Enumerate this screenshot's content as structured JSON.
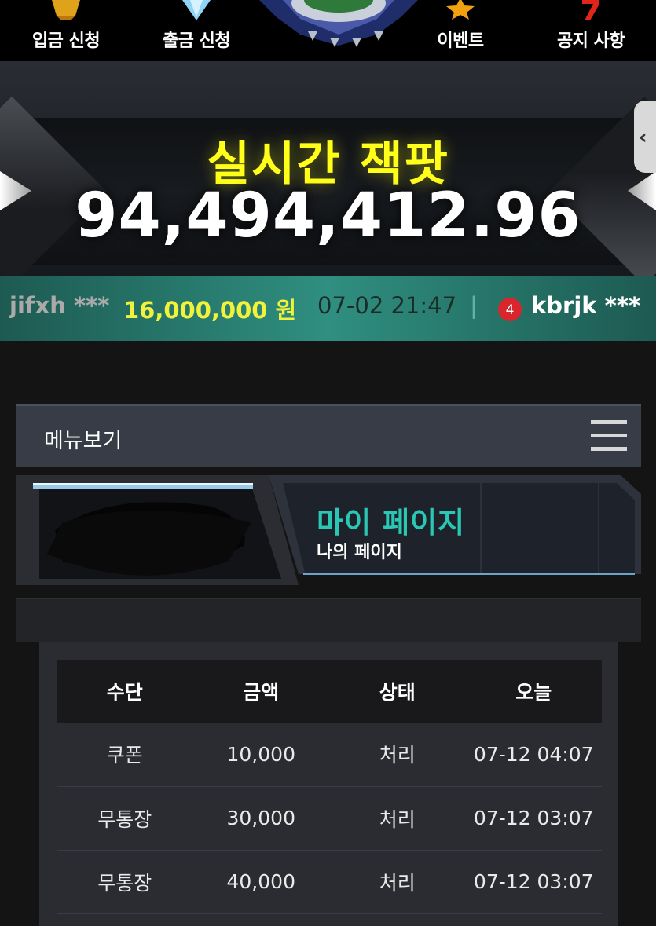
{
  "nav": {
    "items": [
      {
        "label": "입금 신청",
        "icon": "gold-icon"
      },
      {
        "label": "출금 신청",
        "icon": "diamond-icon"
      },
      {
        "label": "이벤트",
        "icon": "star-icon"
      },
      {
        "label": "공지 사항",
        "icon": "seven-icon"
      }
    ]
  },
  "jackpot": {
    "title": "실시간 잭팟",
    "amount": "94,494,412.96"
  },
  "ticker": {
    "user1": "jifxh ***",
    "amount": "16,000,000 원",
    "time": "07-02 21:47",
    "separator": "|",
    "badge": "4",
    "user2": "kbrjk ***"
  },
  "menu": {
    "label": "메뉴보기"
  },
  "mypage": {
    "title": "마이 페이지",
    "subtitle": "나의 페이지"
  },
  "table": {
    "headers": [
      "수단",
      "금액",
      "상태",
      "오늘"
    ],
    "rows": [
      [
        "쿠폰",
        "10,000",
        "처리",
        "07-12 04:07"
      ],
      [
        "무통장",
        "30,000",
        "처리",
        "07-12 03:07"
      ],
      [
        "무통장",
        "40,000",
        "처리",
        "07-12 03:07"
      ]
    ]
  },
  "colors": {
    "jackpot_title": "#ffff1a",
    "ticker_amount": "#f0f33a",
    "mypage_title": "#2ac7b4",
    "ticker_bg": "#2f8f80",
    "badge_red": "#d9262c"
  }
}
